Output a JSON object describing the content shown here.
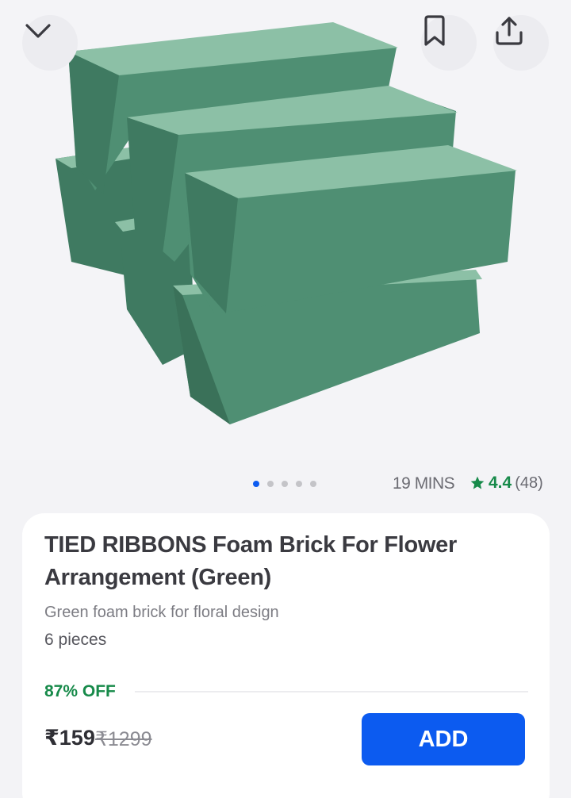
{
  "product": {
    "title": "TIED RIBBONS Foam Brick For Flower Arrangement (Green)",
    "subtitle": "Green foam brick for floral design",
    "quantity": "6 pieces",
    "discount": "87% OFF",
    "price": "₹159",
    "mrp": "₹1299",
    "image_icon": "foam-bricks-image"
  },
  "delivery": {
    "eta": "19 MINS"
  },
  "rating": {
    "value": "4.4",
    "count": "(48)"
  },
  "carousel": {
    "total_dots": 5,
    "active_index": 0
  },
  "actions": {
    "add_label": "ADD"
  },
  "icons": {
    "back": "chevron-down-icon",
    "bookmark": "bookmark-icon",
    "share": "share-icon",
    "star": "star-icon"
  },
  "colors": {
    "accent": "#0c5bf0",
    "success": "#178a4a",
    "foam_light": "#8cc0a6",
    "foam_mid": "#4f8f73",
    "foam_dark": "#3f7a61"
  }
}
